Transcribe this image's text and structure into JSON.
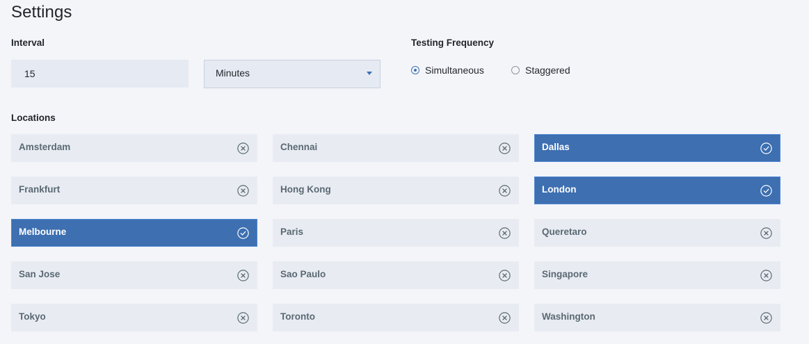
{
  "page": {
    "title": "Settings"
  },
  "interval": {
    "label": "Interval",
    "value": "15",
    "unit_selected": "Minutes"
  },
  "frequency": {
    "label": "Testing Frequency",
    "options": [
      {
        "label": "Simultaneous",
        "checked": true
      },
      {
        "label": "Staggered",
        "checked": false
      }
    ]
  },
  "locations": {
    "label": "Locations",
    "items": [
      {
        "name": "Amsterdam",
        "selected": false
      },
      {
        "name": "Chennai",
        "selected": false
      },
      {
        "name": "Dallas",
        "selected": true
      },
      {
        "name": "Frankfurt",
        "selected": false
      },
      {
        "name": "Hong Kong",
        "selected": false
      },
      {
        "name": "London",
        "selected": true
      },
      {
        "name": "Melbourne",
        "selected": true
      },
      {
        "name": "Paris",
        "selected": false
      },
      {
        "name": "Queretaro",
        "selected": false
      },
      {
        "name": "San Jose",
        "selected": false
      },
      {
        "name": "Sao Paulo",
        "selected": false
      },
      {
        "name": "Singapore",
        "selected": false
      },
      {
        "name": "Tokyo",
        "selected": false
      },
      {
        "name": "Toronto",
        "selected": false
      },
      {
        "name": "Washington",
        "selected": false
      }
    ]
  },
  "icons": {
    "unselected": "close-circle-icon",
    "selected": "checkmark-circle-icon",
    "dropdown": "chevron-down-icon"
  },
  "colors": {
    "accent": "#3d70b2",
    "selected_tile": "#3d6fb1",
    "tile": "#e8ecf2",
    "background": "#f4f5f9"
  }
}
